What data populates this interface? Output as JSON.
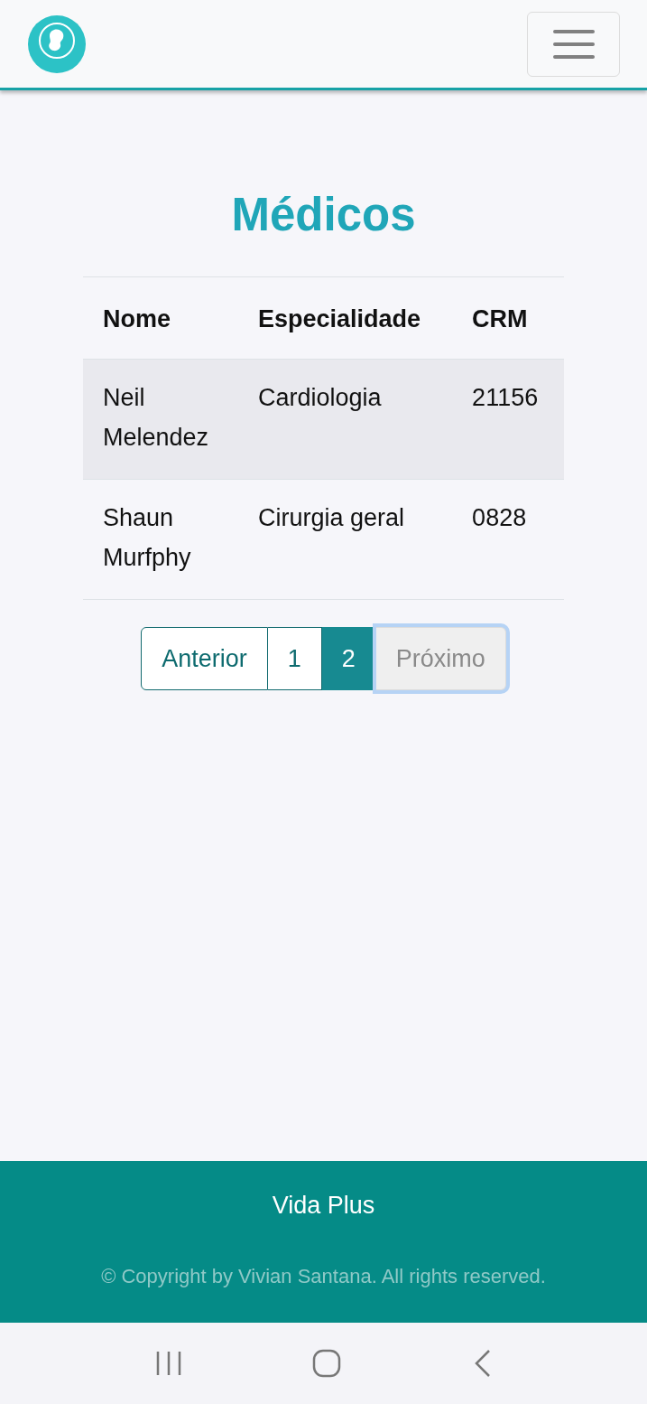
{
  "page_title": "Médicos",
  "table": {
    "columns": [
      "Nome",
      "Especialidade",
      "CRM"
    ],
    "rows": [
      [
        "Neil Melendez",
        "Cardiologia",
        "21156"
      ],
      [
        "Shaun Murfphy",
        "Cirurgia geral",
        "0828"
      ]
    ]
  },
  "pagination": [
    {
      "label": "Anterior",
      "selected": false,
      "disabled": false,
      "focused": false
    },
    {
      "label": "1",
      "selected": false,
      "disabled": false,
      "focused": false
    },
    {
      "label": "2",
      "selected": true,
      "disabled": false,
      "focused": false
    },
    {
      "label": "Próximo",
      "selected": false,
      "disabled": true,
      "focused": true
    }
  ],
  "footer": {
    "brand": "Vida Plus",
    "copyright": "© Copyright by Vivian Santana. All rights reserved."
  }
}
